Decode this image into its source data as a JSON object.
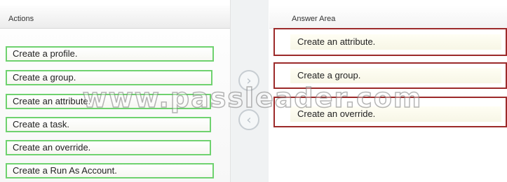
{
  "left_panel": {
    "title": "Actions",
    "items": [
      "Create a profile.",
      "Create a group.",
      "Create an attribute.",
      "Create a task.",
      "Create an override.",
      "Create a Run As Account."
    ]
  },
  "right_panel": {
    "title": "Answer Area",
    "slots": [
      "Create an attribute.",
      "Create a group.",
      "Create an override."
    ]
  },
  "controls": {
    "move_right_icon": "chevron-right-icon",
    "move_left_icon": "chevron-left-icon",
    "move_right_glyph": "›",
    "move_left_glyph": "‹"
  },
  "watermark": "www.passleader.com"
}
